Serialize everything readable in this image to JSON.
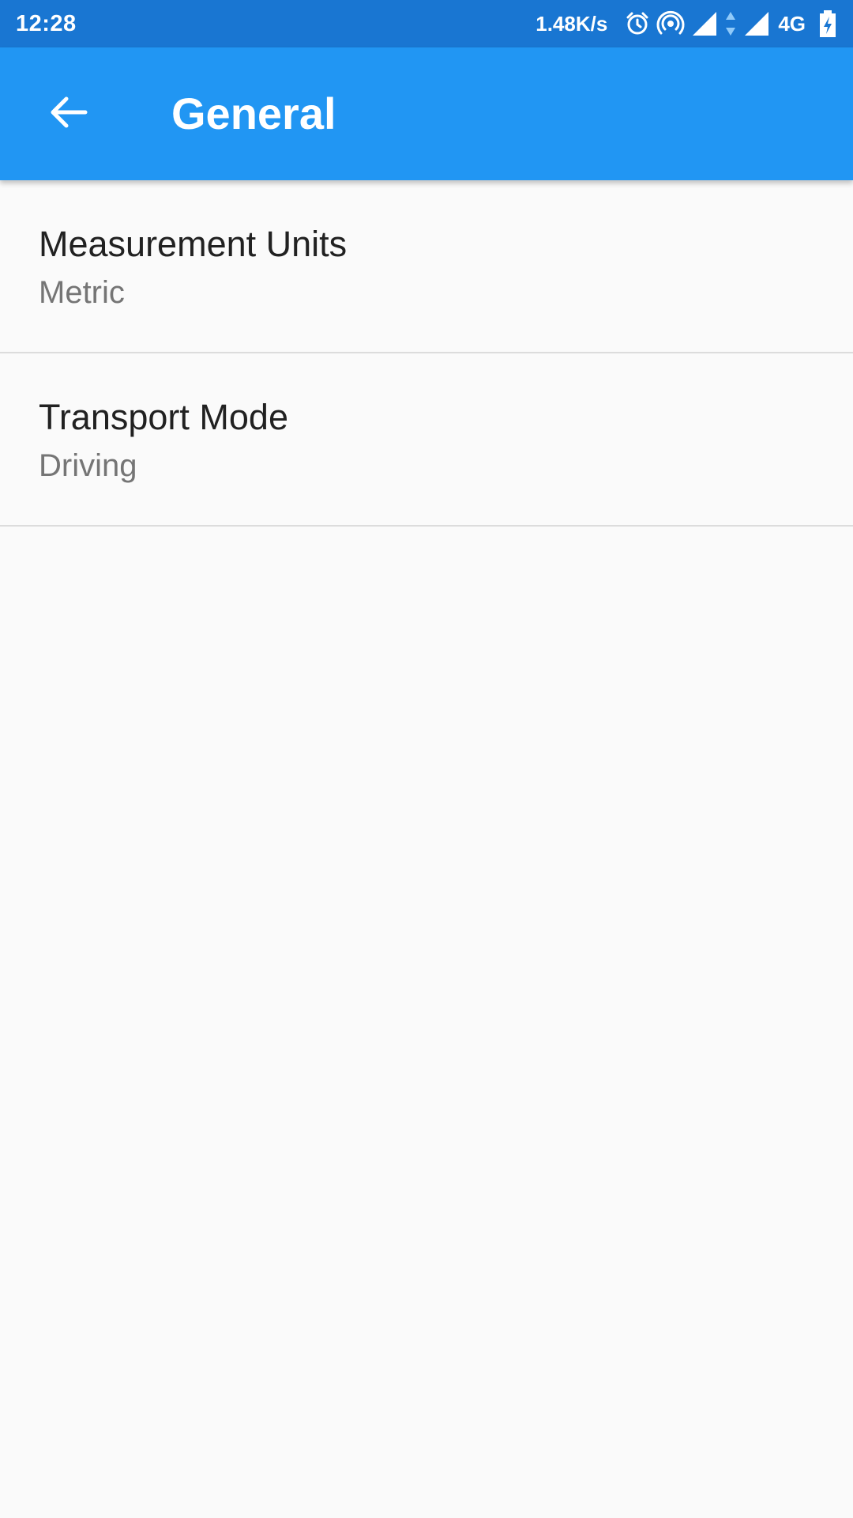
{
  "status_bar": {
    "time": "12:28",
    "network_speed": "1.48K/s",
    "network_type": "4G",
    "icons": [
      "alarm-icon",
      "hotspot-icon",
      "signal-icon",
      "data-arrows-icon",
      "signal-icon",
      "battery-charging-icon"
    ],
    "background": "#1976d2"
  },
  "app_bar": {
    "title": "General",
    "back_icon": "arrow-back-icon",
    "background": "#2196f3"
  },
  "preferences": [
    {
      "title": "Measurement Units",
      "summary": "Metric"
    },
    {
      "title": "Transport Mode",
      "summary": "Driving"
    }
  ]
}
